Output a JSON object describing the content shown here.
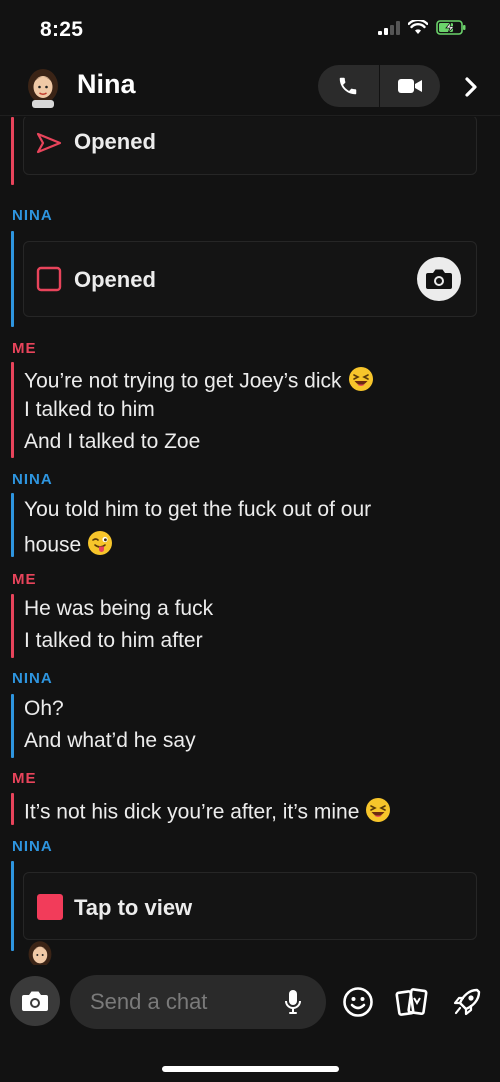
{
  "status_bar": {
    "time": "8:25"
  },
  "header": {
    "contact_name": "Nina"
  },
  "chat": {
    "sender_nina": "NINA",
    "sender_me": "ME",
    "top_card_status": "Opened",
    "nina_card_status": "Opened",
    "me_block_1": [
      "You’re not trying to get Joey’s dick",
      "I talked to him",
      "And I talked to Zoe"
    ],
    "nina_block_1": [
      "You told him to get the fuck out of our",
      "house"
    ],
    "me_block_2": [
      "He was being a fuck",
      "I talked to him after"
    ],
    "nina_block_2": [
      "Oh?",
      "And what’d he say"
    ],
    "me_block_3": [
      "It’s not his dick you’re after, it’s mine"
    ],
    "snap_card_label": "Tap to view"
  },
  "composer": {
    "placeholder": "Send a chat"
  },
  "colors": {
    "me": "#e8445b",
    "nina": "#2e95df",
    "background": "#121212"
  }
}
